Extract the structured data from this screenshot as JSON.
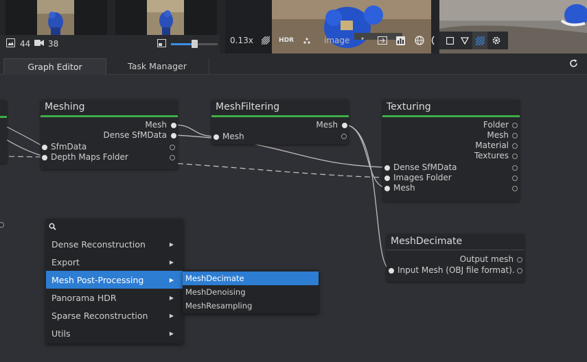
{
  "gallery": {
    "image_count": "44",
    "camera_count": "38"
  },
  "viewer": {
    "zoom": "0.13x",
    "hdr_label": "HDR",
    "channel_select": "image"
  },
  "tabs": [
    {
      "label": "Graph Editor",
      "active": true
    },
    {
      "label": "Task Manager",
      "active": false
    }
  ],
  "nodes": {
    "meshing": {
      "title": "Meshing",
      "outputs": [
        "Mesh",
        "Dense SfMData"
      ],
      "inputs": [
        "SfmData",
        "Depth Maps Folder"
      ]
    },
    "meshfiltering": {
      "title": "MeshFiltering",
      "outputs": [
        "Mesh"
      ],
      "inputs": [
        "Mesh"
      ]
    },
    "texturing": {
      "title": "Texturing",
      "outputs": [
        "Folder",
        "Mesh",
        "Material",
        "Textures"
      ],
      "inputs": [
        "Dense SfMData",
        "Images Folder",
        "Mesh"
      ]
    },
    "meshdecimate": {
      "title": "MeshDecimate",
      "outputs": [
        "Output mesh"
      ],
      "inputs": [
        "Input Mesh (OBJ file format)."
      ]
    }
  },
  "menu": {
    "items": [
      "Dense Reconstruction",
      "Export",
      "Mesh Post-Processing",
      "Panorama HDR",
      "Sparse Reconstruction",
      "Utils"
    ],
    "selected_index": 2,
    "submenu": {
      "items": [
        "MeshDecimate",
        "MeshDenoising",
        "MeshResampling"
      ],
      "selected_index": 0
    }
  },
  "colors": {
    "accent": "#2d7dd2",
    "node_header": "#3fae48",
    "background": "#2f3035"
  },
  "icons": [
    "image-icon",
    "camera-icon",
    "aspect-icon",
    "brush-icon",
    "points-icon",
    "export-icon",
    "chart-icon",
    "globe-icon",
    "square-icon",
    "triangle-icon",
    "hatch-icon",
    "gear-icon",
    "refresh-icon",
    "search-icon",
    "chevron-right-icon"
  ]
}
